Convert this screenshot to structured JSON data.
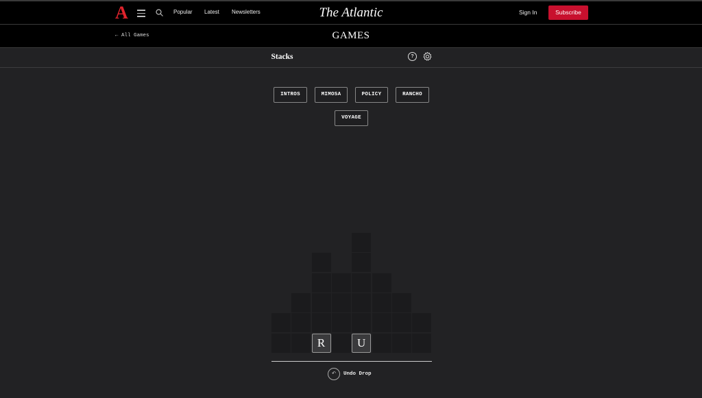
{
  "topbar": {
    "logo": "A",
    "nav": [
      "Popular",
      "Latest",
      "Newsletters"
    ],
    "site_title": "The Atlantic",
    "signin": "Sign In",
    "subscribe": "Subscribe"
  },
  "games_bar": {
    "back_link": "← All Games",
    "title": "GAMES"
  },
  "game": {
    "title": "Stacks",
    "help_symbol": "?",
    "words": [
      "INTROS",
      "MIMOSA",
      "POLICY",
      "RANCHO",
      "VOYAGE"
    ],
    "placed_tiles": [
      "R",
      "U"
    ],
    "undo_label": "Undo Drop",
    "undo_icon": "undo-arrow-icon"
  },
  "colors": {
    "brand_red": "#e0232c",
    "subscribe_bg": "#c8102e",
    "background": "#222224"
  }
}
